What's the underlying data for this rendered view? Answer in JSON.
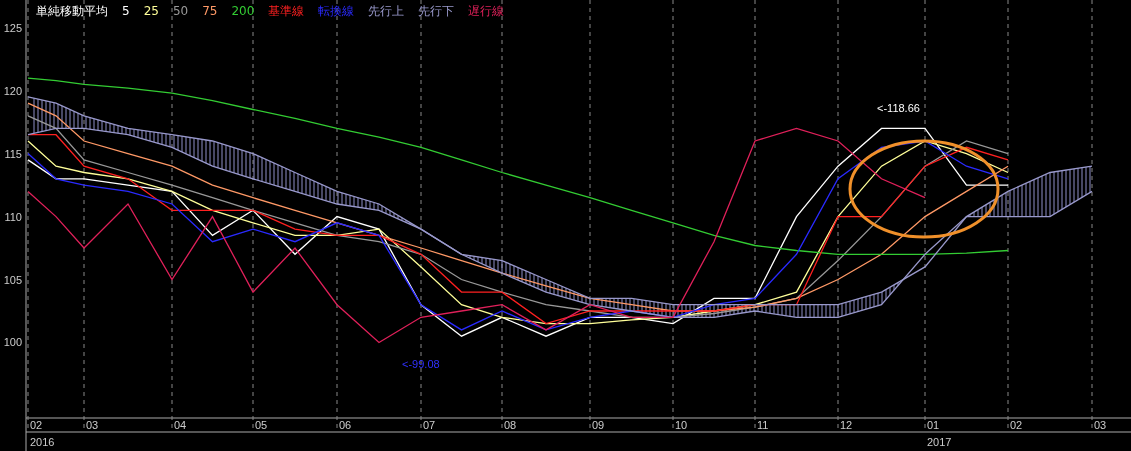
{
  "chart": {
    "legend_title": "単純移動平均",
    "chart_data": {
      "type": "line",
      "categories": [
        "02",
        null,
        "03",
        null,
        "04",
        null,
        "05",
        null,
        "06",
        null,
        "07",
        null,
        "08",
        null,
        "09",
        null,
        "10",
        null,
        "11",
        null,
        "12",
        null,
        "01",
        null,
        "02",
        null,
        "03"
      ],
      "yticks": [
        100,
        105,
        110,
        115,
        120,
        125
      ],
      "ylim": [
        94,
        127.2
      ],
      "series": [
        {
          "name": "5",
          "color": "#ffffff",
          "values": [
            114.5,
            113,
            113,
            112.5,
            112,
            108.5,
            110.5,
            107,
            110,
            109,
            103,
            100.5,
            102,
            100.5,
            102,
            102,
            101.5,
            103.5,
            103.5,
            110,
            114,
            117,
            117,
            112.5,
            112.5,
            null,
            null
          ]
        },
        {
          "name": "25",
          "color": "#ffff99",
          "values": [
            116,
            114,
            113.5,
            113,
            112,
            110.5,
            109.5,
            108.5,
            108.5,
            109,
            106,
            103,
            102,
            101.5,
            101.5,
            101.8,
            102,
            102.5,
            103,
            104,
            110,
            114,
            116,
            115,
            113.5,
            null,
            null
          ]
        },
        {
          "name": "50",
          "color": "#999999",
          "values": [
            118,
            117,
            114.5,
            113.5,
            112.5,
            111.5,
            110.5,
            109.5,
            108.5,
            108,
            107,
            105,
            104,
            103,
            102.5,
            102,
            102,
            102.3,
            102.8,
            103.5,
            106.5,
            110,
            114,
            116,
            115,
            null,
            null
          ]
        },
        {
          "name": "75",
          "color": "#ff9966",
          "values": [
            119,
            118,
            116,
            115,
            114,
            112.5,
            111.5,
            110.5,
            109.5,
            108.5,
            107.5,
            106.5,
            105.5,
            104.5,
            103.5,
            103,
            102.5,
            102.5,
            102.8,
            103.5,
            105,
            107,
            110,
            112,
            114,
            null,
            null
          ]
        },
        {
          "name": "200",
          "color": "#33cc33",
          "values": [
            121,
            120.8,
            120.5,
            120.2,
            119.8,
            119.2,
            118.5,
            117.8,
            117,
            116.3,
            115.5,
            114.5,
            113.5,
            112.5,
            111.5,
            110.5,
            109.5,
            108.5,
            107.7,
            107.3,
            107,
            107,
            107,
            107.1,
            107.3,
            null,
            null
          ]
        },
        {
          "name": "基準線",
          "color": "#ff2020",
          "values": [
            116.5,
            116.5,
            114,
            113,
            110.5,
            110.5,
            110.5,
            109,
            108.5,
            108.5,
            107,
            104,
            104,
            101.5,
            102.5,
            102.5,
            102.5,
            102.5,
            103,
            103,
            110,
            110,
            114,
            115.5,
            114.5,
            null,
            null
          ]
        },
        {
          "name": "転換線",
          "color": "#2a2aff",
          "values": [
            115,
            113,
            112.5,
            112,
            111,
            108,
            109,
            108,
            109.5,
            108.5,
            103,
            101,
            102.5,
            101,
            102,
            102.5,
            102,
            103,
            103.5,
            107,
            113,
            115.5,
            116,
            114,
            113,
            null,
            null
          ]
        },
        {
          "name": "先行上",
          "color": "#9999cc",
          "values": [
            119.5,
            119,
            118,
            117,
            116.5,
            116,
            115,
            113.5,
            112,
            111,
            109,
            107,
            106.5,
            105,
            103.5,
            103.5,
            103,
            103,
            103,
            103,
            103,
            104,
            106,
            110,
            112,
            113.5,
            114
          ]
        },
        {
          "name": "先行下",
          "color": "#9999cc",
          "values": [
            116.5,
            117,
            117,
            116.5,
            115.5,
            114,
            113,
            112,
            111,
            110.5,
            109,
            107,
            105.5,
            104,
            103,
            102.5,
            102,
            102,
            102.5,
            102,
            102,
            103,
            107,
            110,
            110,
            110,
            112
          ]
        },
        {
          "name": "遅行線",
          "color": "#e0205a",
          "values": [
            112,
            110,
            107.5,
            111,
            105,
            110,
            104,
            107.5,
            103,
            100,
            102,
            102.5,
            103,
            101,
            103,
            102,
            102,
            108,
            116,
            117,
            116,
            113,
            111.5,
            null,
            null,
            null,
            null
          ]
        }
      ],
      "annotations": [
        "2016",
        "2017",
        "<-118.66",
        "<-99.08"
      ]
    }
  }
}
